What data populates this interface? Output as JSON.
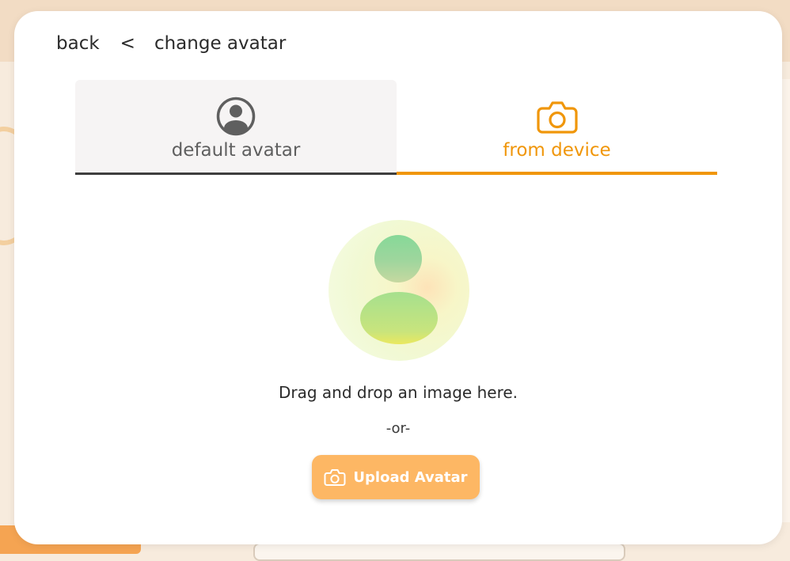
{
  "header": {
    "back_label": "back",
    "separator": "<",
    "title": "change avatar"
  },
  "tabs": [
    {
      "id": "default",
      "label": "default avatar",
      "icon": "user-circle-icon",
      "active": false
    },
    {
      "id": "device",
      "label": "from device",
      "icon": "camera-icon",
      "active": true
    }
  ],
  "upload": {
    "drag_text": "Drag and drop an image here.",
    "or_text": "-or-",
    "button_label": "Upload Avatar",
    "button_icon": "camera-icon"
  },
  "colors": {
    "accent": "#f0960a",
    "button": "#fdb764",
    "inactive_tab_bg": "#f6f4f4"
  }
}
